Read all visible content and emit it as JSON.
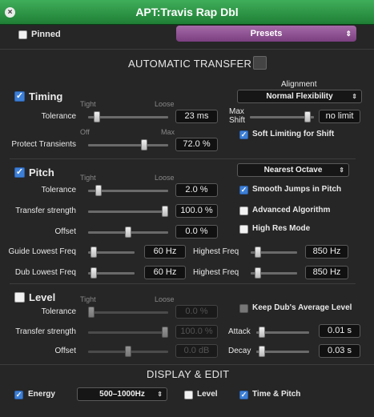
{
  "window": {
    "title": "APT:Travis Rap Dbl"
  },
  "top": {
    "pinned_label": "Pinned",
    "presets_label": "Presets"
  },
  "auto_transfer": {
    "title": "AUTOMATIC TRANSFER"
  },
  "timing": {
    "label": "Timing",
    "scale_low": "Tight",
    "scale_high": "Loose",
    "tolerance_label": "Tolerance",
    "tolerance_value": "23 ms",
    "protect_label": "Protect Transients",
    "protect_off": "Off",
    "protect_max": "Max",
    "protect_value": "72.0 %",
    "alignment_label": "Alignment",
    "alignment_value": "Normal Flexibility",
    "max_shift_label1": "Max",
    "max_shift_label2": "Shift",
    "max_shift_value": "no limit",
    "soft_limit_label": "Soft Limiting for Shift"
  },
  "pitch": {
    "label": "Pitch",
    "scale_low": "Tight",
    "scale_high": "Loose",
    "octave_value": "Nearest Octave",
    "tolerance_label": "Tolerance",
    "tolerance_value": "2.0 %",
    "smooth_label": "Smooth Jumps in Pitch",
    "transfer_label": "Transfer strength",
    "transfer_value": "100.0 %",
    "advanced_label": "Advanced Algorithm",
    "offset_label": "Offset",
    "offset_value": "0.0 %",
    "highres_label": "High Res Mode",
    "guide_low_label": "Guide Lowest Freq",
    "guide_low_value": "60 Hz",
    "guide_high_label": "Highest Freq",
    "guide_high_value": "850 Hz",
    "dub_low_label": "Dub Lowest Freq",
    "dub_low_value": "60 Hz",
    "dub_high_label": "Highest Freq",
    "dub_high_value": "850 Hz"
  },
  "level": {
    "label": "Level",
    "scale_low": "Tight",
    "scale_high": "Loose",
    "tolerance_label": "Tolerance",
    "tolerance_value": "0.0 %",
    "keep_label": "Keep Dub's Average Level",
    "transfer_label": "Transfer strength",
    "transfer_value": "100.0 %",
    "attack_label": "Attack",
    "attack_value": "0.01 s",
    "offset_label": "Offset",
    "offset_value": "0.0 dB",
    "decay_label": "Decay",
    "decay_value": "0.03 s"
  },
  "display": {
    "title": "DISPLAY & EDIT",
    "energy_label": "Energy",
    "energy_range": "500–1000Hz",
    "level_label": "Level",
    "timepitch_label": "Time & Pitch"
  },
  "sliders": {
    "timing_tolerance": 0.08,
    "timing_protect": 0.72,
    "max_shift": 0.95,
    "pitch_tolerance": 0.1,
    "pitch_transfer": 1.0,
    "pitch_offset": 0.5,
    "guide_low": 0.05,
    "guide_high": 0.1,
    "dub_low": 0.05,
    "dub_high": 0.1,
    "level_tolerance": 0.0,
    "level_transfer": 1.0,
    "level_offset": 0.5,
    "attack": 0.05,
    "decay": 0.05
  },
  "checkbox_state": {
    "pinned": false,
    "timing": true,
    "soft_limit": true,
    "pitch": true,
    "smooth": true,
    "advanced": false,
    "highres": false,
    "level": false,
    "keep": false,
    "energy": true,
    "display_level": false,
    "timepitch": true
  },
  "colors": {
    "titlebar": "#2e9a48",
    "presets": "#8e5392",
    "check": "#3d7fd6"
  }
}
